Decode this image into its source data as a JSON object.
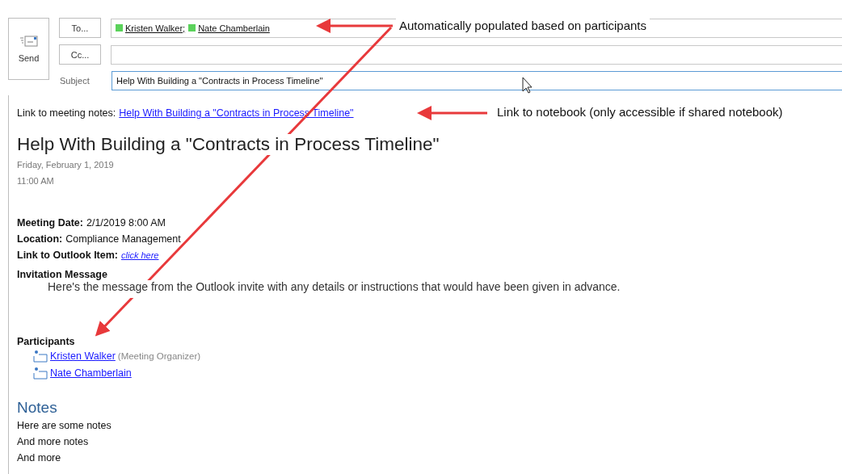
{
  "compose": {
    "send_label": "Send",
    "to_button": "To...",
    "cc_button": "Cc...",
    "subject_label": "Subject",
    "recipients": [
      {
        "name": "Kristen Walker",
        "separator": ";",
        "color": "#5bd25b"
      },
      {
        "name": "Nate Chamberlain",
        "color": "#5bd25b"
      }
    ],
    "subject": "Help With Building a \"Contracts in Process Timeline\""
  },
  "body": {
    "link_prefix": "Link to meeting notes:",
    "link_text": "Help With Building a \"Contracts in Process Timeline\"",
    "title": "Help With Building a \"Contracts in Process Timeline\"",
    "date": "Friday, February 1, 2019",
    "time": "11:00 AM",
    "details": [
      {
        "label": "Meeting Date:",
        "value": "2/1/2019 8:00 AM",
        "kind": "text"
      },
      {
        "label": "Location:",
        "value": "Compliance Management",
        "kind": "text"
      },
      {
        "label": "Link to Outlook Item:",
        "value": "click here",
        "kind": "link"
      }
    ],
    "invitation_heading": "Invitation Message",
    "invitation_text": "Here's the message from the Outlook invite with any details or instructions that would have been given in advance.",
    "participants_heading": "Participants",
    "participants": [
      {
        "name": "Kristen Walker ",
        "role": "(Meeting Organizer)"
      },
      {
        "name": "Nate Chamberlain"
      }
    ],
    "notes_heading": "Notes",
    "notes": [
      "Here are some notes",
      "And more notes",
      "And more"
    ]
  },
  "annotations": [
    "Automatically populated based on participants",
    "Link to notebook (only accessible if shared notebook)"
  ]
}
